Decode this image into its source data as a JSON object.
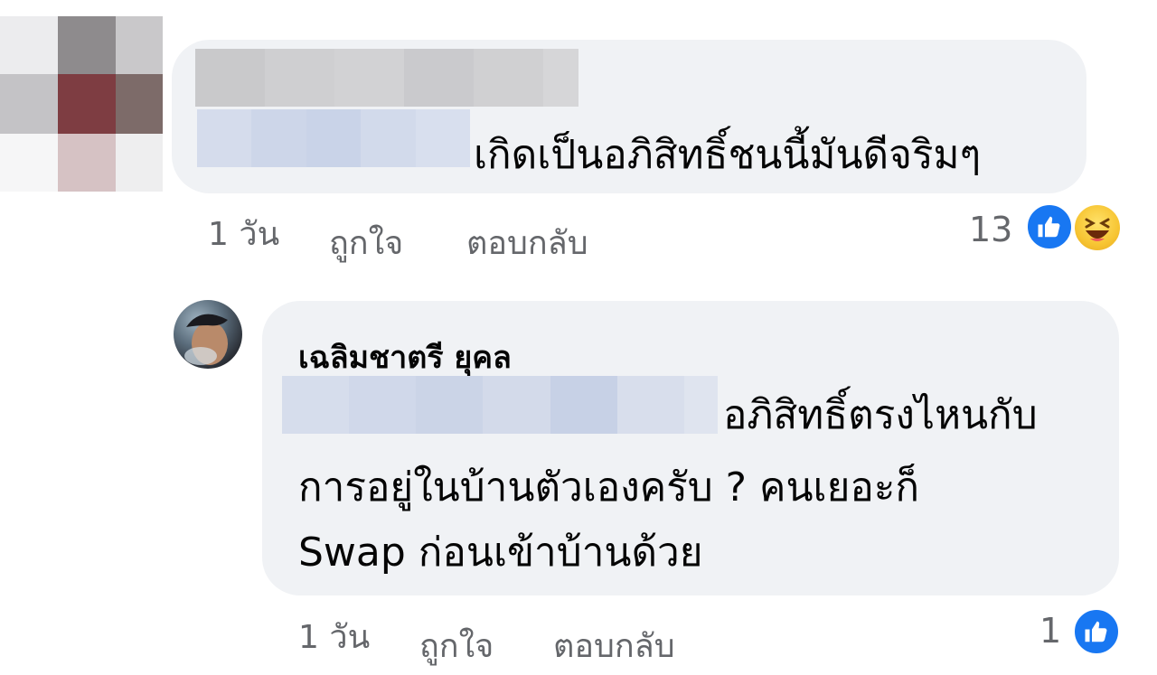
{
  "comment1": {
    "text": "เกิดเป็นอภิสิทธิ์ชนนี้มันดีจริมๆ",
    "time": "1 วัน",
    "like_label": "ถูกใจ",
    "reply_label": "ตอบกลับ",
    "reaction_count": "13",
    "reactions": [
      "like-icon",
      "haha-icon"
    ]
  },
  "comment2": {
    "author": "เฉลิมชาตรี ยุคล",
    "text_line1": "อภิสิทธิ์ตรงไหนกับ",
    "text_line2": "การอยู่ในบ้านตัวเองครับ ? คนเยอะก็",
    "text_line3": "Swap ก่อนเข้าบ้านด้วย",
    "time": "1 วัน",
    "like_label": "ถูกใจ",
    "reply_label": "ตอบกลับ",
    "reaction_count": "1",
    "reactions": [
      "like-icon"
    ]
  },
  "colors": {
    "bubble": "#f0f2f5",
    "meta_text": "#65676b",
    "like_blue": "#1877f2",
    "mention_blur": "#c9d4e8",
    "name_blur": "#c8c8ca"
  }
}
